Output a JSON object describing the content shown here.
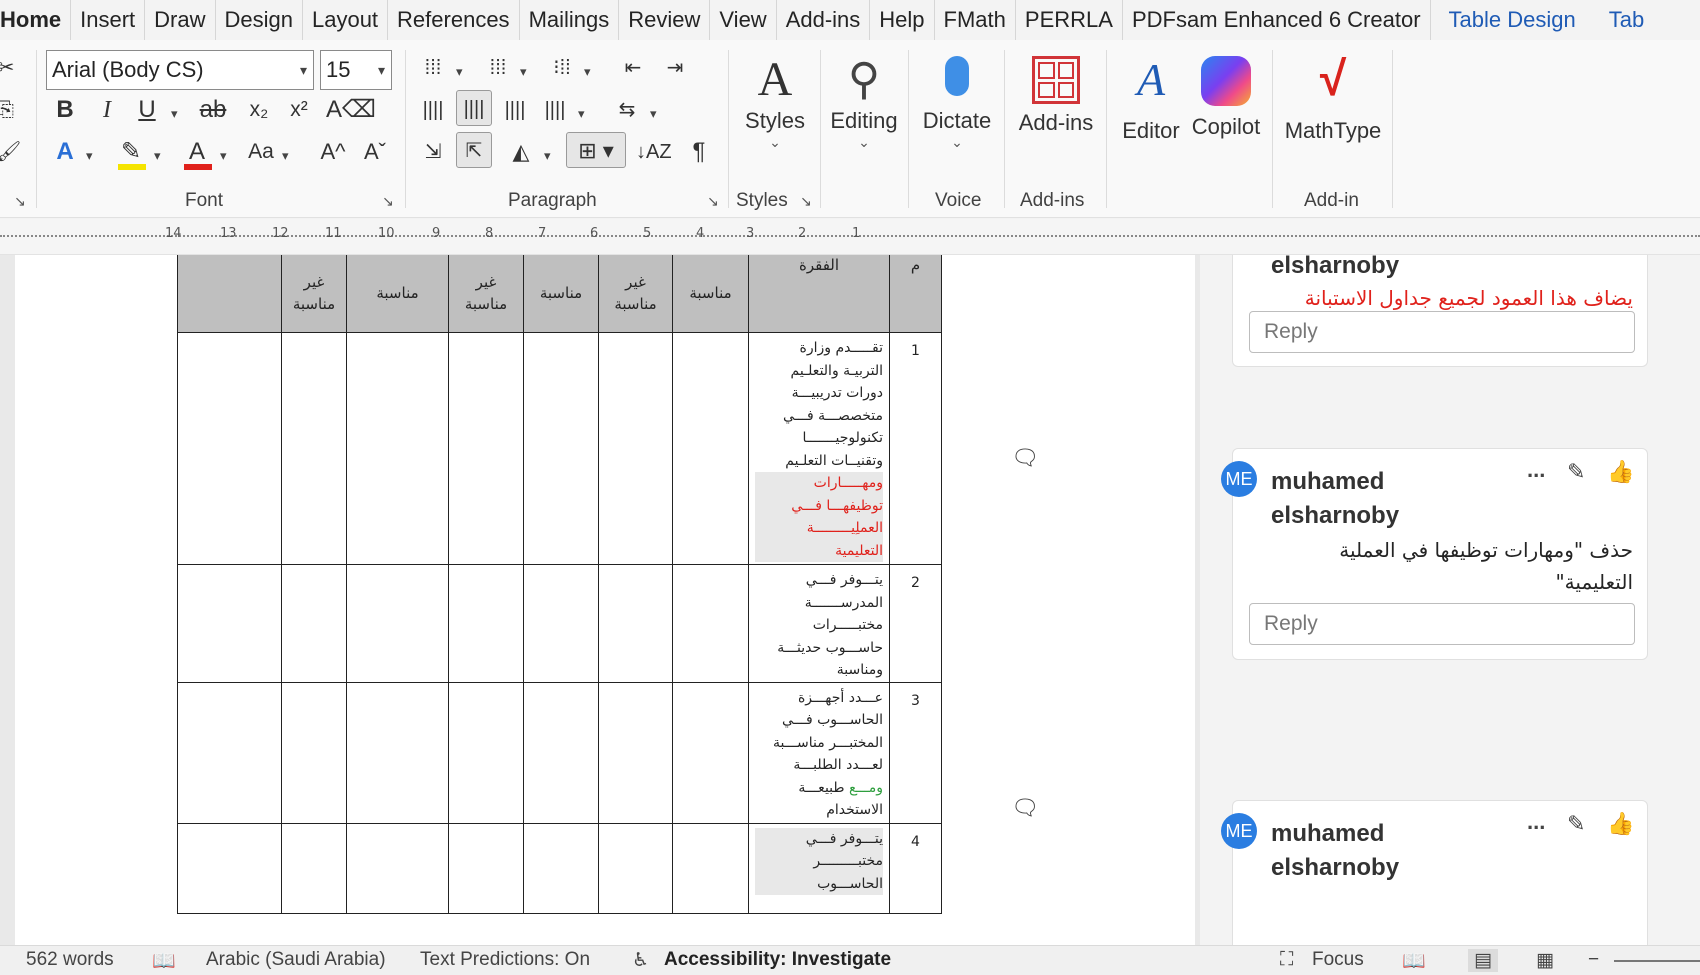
{
  "tabs": [
    "Home",
    "Insert",
    "Draw",
    "Design",
    "Layout",
    "References",
    "Mailings",
    "Review",
    "View",
    "Add-ins",
    "Help",
    "FMath",
    "PERRLA",
    "PDFsam Enhanced 6 Creator",
    "Table Design",
    "Tab"
  ],
  "ribbon": {
    "font_name": "Arial (Body CS)",
    "font_size": "15",
    "groups": {
      "font": "Font",
      "paragraph": "Paragraph",
      "styles": "Styles",
      "voice": "Voice",
      "addins": "Add-ins",
      "addin": "Add-in"
    },
    "buttons": {
      "styles": "Styles",
      "editing": "Editing",
      "dictate": "Dictate",
      "addins": "Add-ins",
      "editor": "Editor",
      "copilot": "Copilot",
      "mathtype": "MathType"
    },
    "font_buttons": {
      "bold": "B",
      "italic": "I",
      "underline": "U",
      "strike": "ab",
      "subscript": "x₂",
      "superscript": "x²",
      "text_effects": "A",
      "font_color": "A",
      "change_case": "Aa",
      "grow": "A^",
      "shrink": "Aˇ"
    },
    "colors": {
      "highlight": "#f5e400",
      "font_color": "#e0211b",
      "addins_red": "#d13438",
      "mathtype_red": "#d9231d"
    }
  },
  "ruler": {
    "numbers": [
      "14",
      "13",
      "12",
      "11",
      "10",
      "9",
      "8",
      "7",
      "6",
      "5",
      "4",
      "3",
      "2",
      "1"
    ]
  },
  "table": {
    "header": {
      "col_ar": "غير",
      "col_ar2": "مناسبة",
      "col_mid": "مناسبة",
      "item_head": "الفقرة",
      "num_head": "م"
    },
    "rows": [
      {
        "num": "1",
        "lines": [
          "تقـــــدم وزارة",
          "التربيـة والتعلـيم",
          "دورات تدريبيـــة",
          "متخصصـــة فـــي",
          "تكنولوجيـــــــا",
          "وتقنيــات التعلـيم"
        ],
        "red_lines": [
          "ومهـــــارات",
          "توظيفهـــا فـــي",
          "العملِيـــــــــة",
          "التعليمية"
        ]
      },
      {
        "num": "2",
        "lines": [
          "يتـــوفر فـــي",
          "المدرســـــــة",
          "مختبـــــرات",
          "حاســـوب حديثـــة",
          "ومناسبة"
        ],
        "red_lines": []
      },
      {
        "num": "3",
        "lines": [
          "عـــدد أجهـــزة",
          "الحاســـوب فـــي",
          "المختبـــر مناســـبة",
          "لعـــدد الطلبـــة"
        ],
        "green_word": "ومـــع",
        "tail": "طبيعـــة",
        "last": "الاستخدام"
      },
      {
        "num": "4",
        "lines": [
          "يتـــوفر فـــي",
          "مختبـــــــــر",
          "الحاســـوب"
        ],
        "red_lines": []
      }
    ]
  },
  "comments": {
    "c0": {
      "name_tail": "elsharnoby",
      "text": "يضاف هذا العمود لجميع جداول الاستبانة",
      "reply": "Reply"
    },
    "c1": {
      "avatar": "ME",
      "name1": "muhamed",
      "name2": "elsharnoby",
      "text1": "حذف \"ومهارات توظيفها في العملية",
      "text2": "التعليمية\"",
      "reply": "Reply",
      "more": "..."
    },
    "c2": {
      "avatar": "ME",
      "name1": "muhamed",
      "name2": "elsharnoby",
      "more": "..."
    }
  },
  "status": {
    "words": "562 words",
    "language": "Arabic (Saudi Arabia)",
    "predictions": "Text Predictions: On",
    "accessibility": "Accessibility: Investigate",
    "focus": "Focus"
  }
}
